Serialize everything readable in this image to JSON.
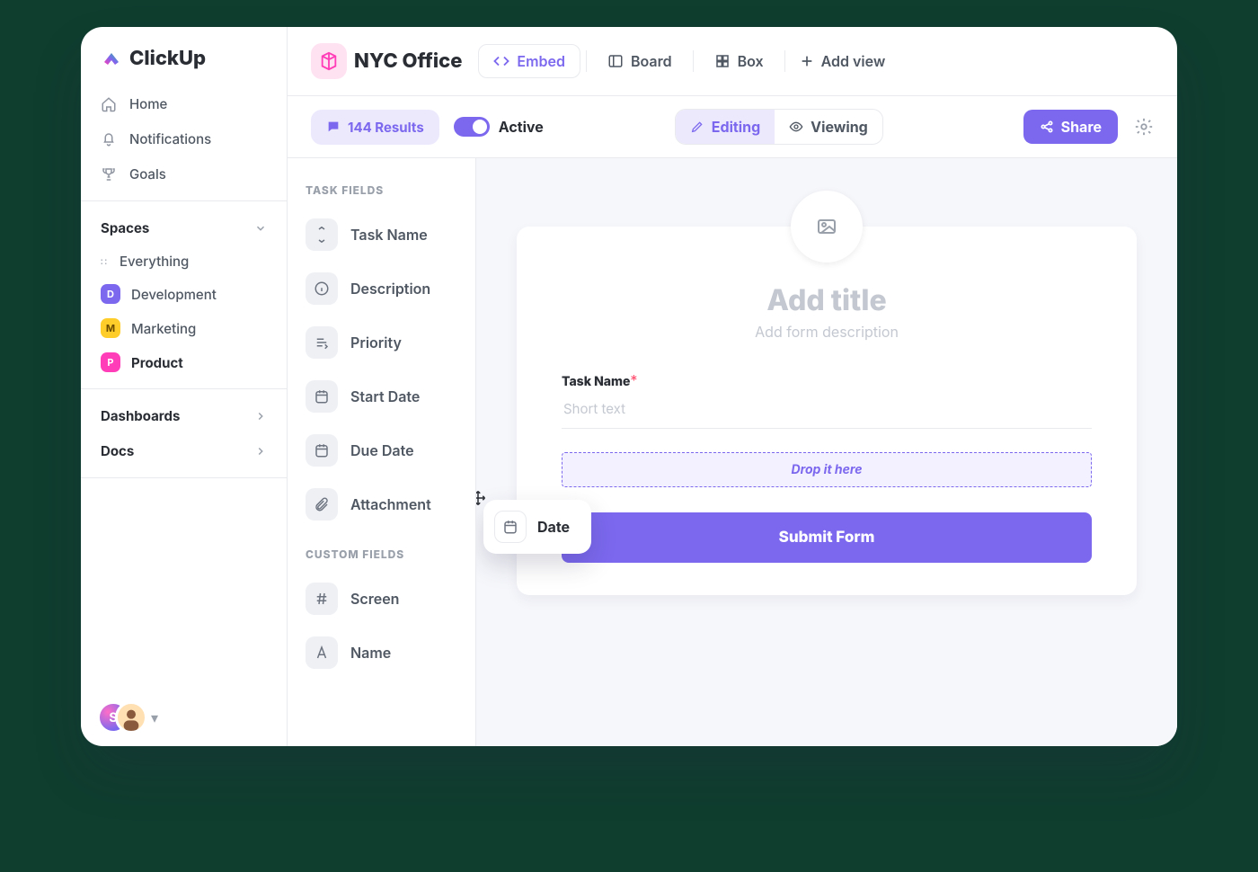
{
  "brand": "ClickUp",
  "sidebar": {
    "nav": [
      {
        "icon": "home",
        "label": "Home"
      },
      {
        "icon": "bell",
        "label": "Notifications"
      },
      {
        "icon": "trophy",
        "label": "Goals"
      }
    ],
    "spaces_header": "Spaces",
    "spaces": [
      {
        "icon": "grid",
        "label": "Everything"
      },
      {
        "badge": "D",
        "badge_cls": "d",
        "label": "Development"
      },
      {
        "badge": "M",
        "badge_cls": "m",
        "label": "Marketing"
      },
      {
        "badge": "P",
        "badge_cls": "p",
        "label": "Product",
        "active": true
      }
    ],
    "sections": [
      {
        "label": "Dashboards"
      },
      {
        "label": "Docs"
      }
    ],
    "avatar_initial": "S"
  },
  "header": {
    "space_title": "NYC Office",
    "view_tabs": [
      {
        "icon": "code",
        "label": "Embed",
        "active": true
      },
      {
        "icon": "board",
        "label": "Board"
      },
      {
        "icon": "box",
        "label": "Box"
      }
    ],
    "add_view": "Add view"
  },
  "toolbar": {
    "results_count": "144 Results",
    "active_label": "Active",
    "mode": {
      "editing": "Editing",
      "viewing": "Viewing"
    },
    "share": "Share"
  },
  "fields_panel": {
    "task_header": "TASK FIELDS",
    "task_fields": [
      {
        "icon": "expand",
        "label": "Task Name"
      },
      {
        "icon": "info",
        "label": "Description"
      },
      {
        "icon": "priority",
        "label": "Priority"
      },
      {
        "icon": "calendar",
        "label": "Start Date"
      },
      {
        "icon": "calendar",
        "label": "Due Date"
      },
      {
        "icon": "clip",
        "label": "Attachment"
      }
    ],
    "custom_header": "CUSTOM FIELDS",
    "custom_fields": [
      {
        "icon": "hash",
        "label": "Screen"
      },
      {
        "icon": "type",
        "label": "Name"
      }
    ]
  },
  "form": {
    "title_placeholder": "Add title",
    "subtitle_placeholder": "Add form description",
    "field1_label": "Task Name",
    "field1_placeholder": "Short text",
    "drop_hint": "Drop it here",
    "submit": "Submit Form"
  },
  "drag_chip_label": "Date"
}
